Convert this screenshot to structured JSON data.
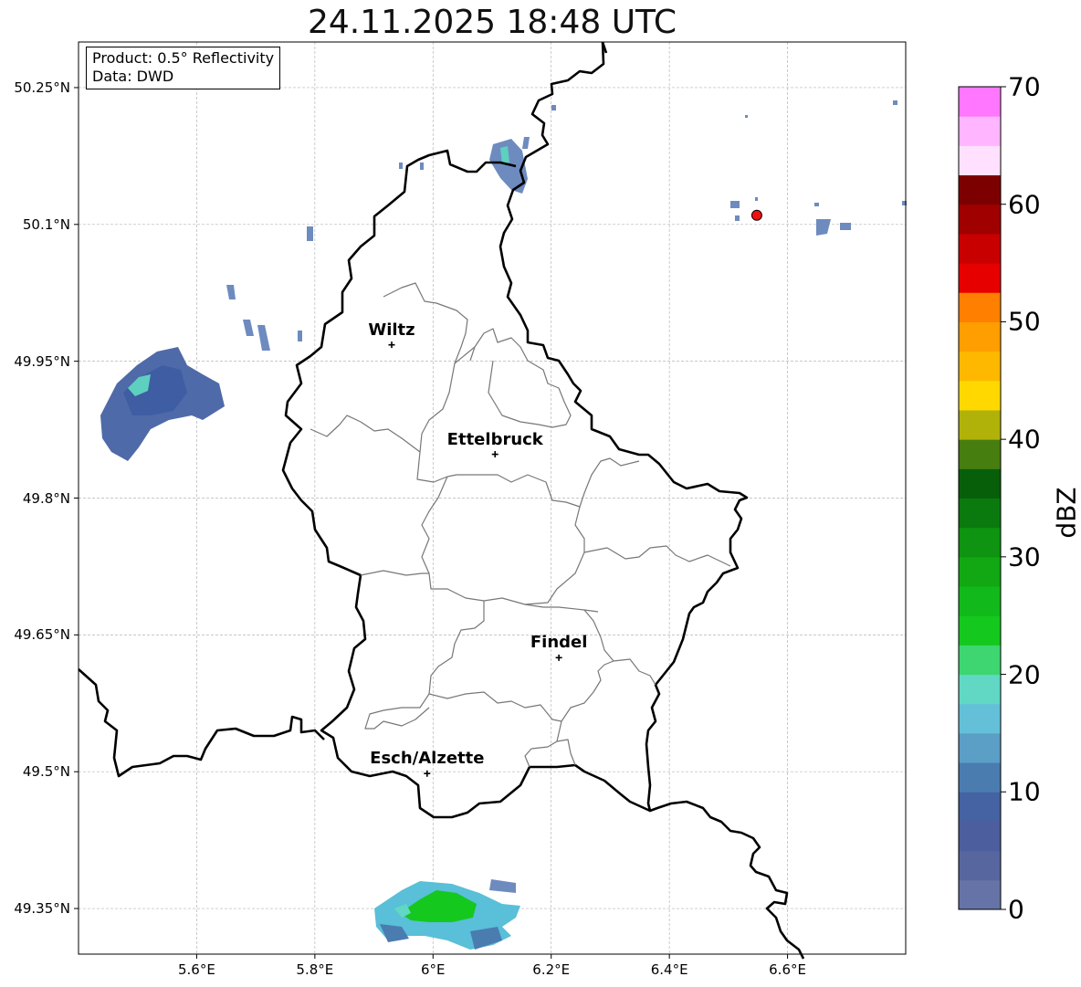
{
  "title": "24.11.2025 18:48 UTC",
  "info": {
    "product": "Product: 0.5° Reflectivity",
    "data": "Data: DWD"
  },
  "axes": {
    "lon_range": [
      5.4,
      6.8
    ],
    "lat_range": [
      49.3,
      50.3
    ],
    "lon_ticks": [
      5.6,
      5.8,
      6.0,
      6.2,
      6.4,
      6.6
    ],
    "lon_labels": [
      "5.6°E",
      "5.8°E",
      "6°E",
      "6.2°E",
      "6.4°E",
      "6.6°E"
    ],
    "lat_ticks": [
      50.25,
      50.1,
      49.95,
      49.8,
      49.65,
      49.5,
      49.35
    ],
    "lat_labels": [
      "50.25°N",
      "50.1°N",
      "49.95°N",
      "49.8°N",
      "49.65°N",
      "49.5°N",
      "49.35°N"
    ]
  },
  "cities": [
    {
      "name": "Wiltz",
      "lon": 5.93,
      "lat": 49.968
    },
    {
      "name": "Ettelbruck",
      "lon": 6.105,
      "lat": 49.848
    },
    {
      "name": "Findel",
      "lon": 6.213,
      "lat": 49.625
    },
    {
      "name": "Esch/Alzette",
      "lon": 5.99,
      "lat": 49.498
    }
  ],
  "radar_site": {
    "lon": 6.548,
    "lat": 50.11,
    "color": "#ee1111"
  },
  "colorbar": {
    "unit": "dBZ",
    "min": 0,
    "max": 70,
    "step": 2.5,
    "tick_values": [
      0,
      10,
      20,
      30,
      40,
      50,
      60,
      70
    ],
    "tick_labels": [
      "0",
      "10",
      "20",
      "30",
      "40",
      "50",
      "60",
      "70"
    ],
    "colors": [
      "#6673a6",
      "#5866a0",
      "#4c5e9e",
      "#4562a3",
      "#4a7cb0",
      "#5b9ec6",
      "#64c0d8",
      "#60d8c4",
      "#3ed670",
      "#14c81e",
      "#12b91a",
      "#11a813",
      "#0e9410",
      "#0b7a0e",
      "#075f09",
      "#477e10",
      "#b0b20a",
      "#ffd800",
      "#ffb800",
      "#ff9e00",
      "#ff7f00",
      "#e60000",
      "#c80000",
      "#a00000",
      "#7d0000",
      "#ffe0ff",
      "#ffb5ff",
      "#ff77ff",
      "#f037ef"
    ]
  }
}
